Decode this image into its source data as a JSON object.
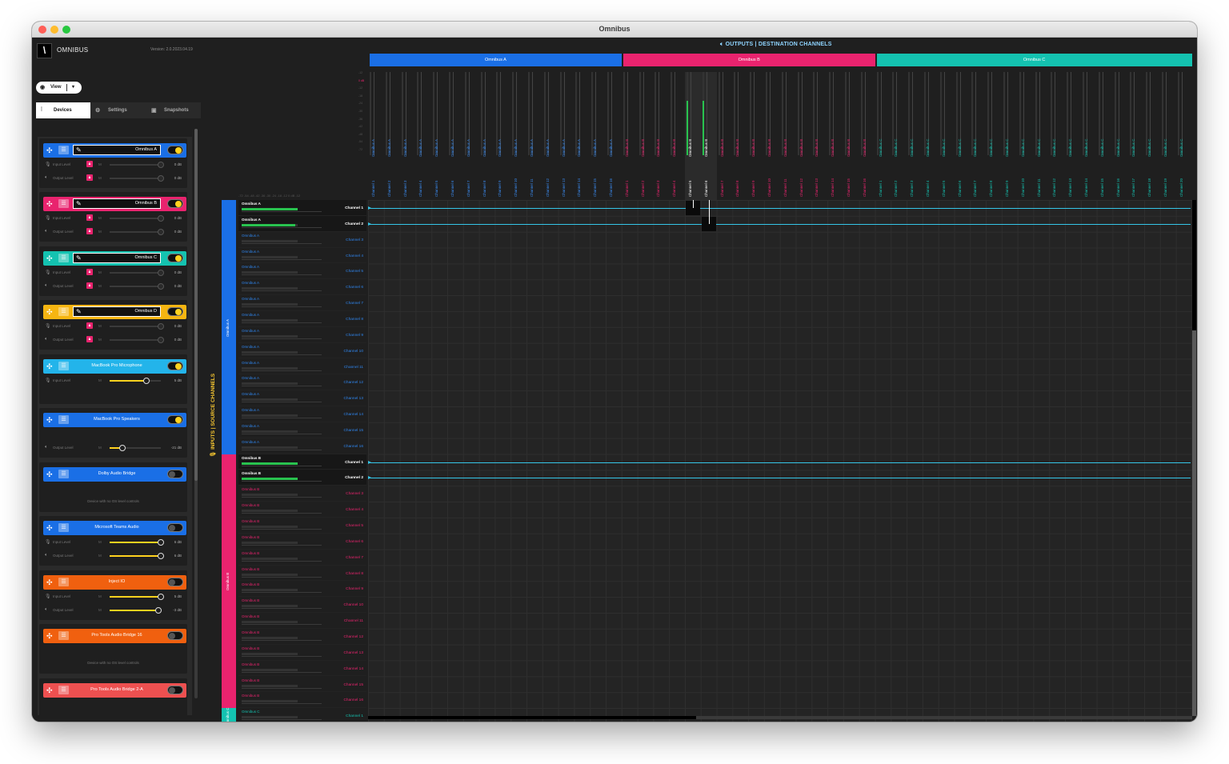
{
  "window": {
    "title": "Omnibus"
  },
  "app": {
    "logo": "\\",
    "name": "OMNIBUS",
    "version": "Version: 2.0.2023.04.19"
  },
  "view_button": {
    "label": "View",
    "icon": "eye-icon",
    "dropdown": "▾"
  },
  "tabs": [
    {
      "label": "Devices",
      "icon": "devices-icon"
    },
    {
      "label": "Settings",
      "icon": "gear-icon"
    },
    {
      "label": "Snapshots",
      "icon": "snapshot-icon"
    }
  ],
  "device_labels": {
    "input_level": "Input Level",
    "output_level": "Output Level",
    "mute": "M",
    "no_os": "Device with no OS level controls"
  },
  "devices": [
    {
      "name": "Omnibus A",
      "color": "#1a6fe6",
      "enabled": true,
      "editable": true,
      "rows": [
        {
          "kind": "input",
          "db": "0 dB",
          "level": 0
        },
        {
          "kind": "output",
          "db": "0 dB",
          "level": 0
        }
      ]
    },
    {
      "name": "Omnibus B",
      "color": "#e9236e",
      "enabled": true,
      "editable": true,
      "rows": [
        {
          "kind": "input",
          "db": "0 dB",
          "level": 0
        },
        {
          "kind": "output",
          "db": "0 dB",
          "level": 0
        }
      ]
    },
    {
      "name": "Omnibus C",
      "color": "#14c2b0",
      "enabled": true,
      "editable": true,
      "rows": [
        {
          "kind": "input",
          "db": "0 dB",
          "level": 0
        },
        {
          "kind": "output",
          "db": "0 dB",
          "level": 0
        }
      ]
    },
    {
      "name": "Omnibus D",
      "color": "#f6b511",
      "enabled": true,
      "editable": true,
      "rows": [
        {
          "kind": "input",
          "db": "0 dB",
          "level": 0
        },
        {
          "kind": "output",
          "db": "0 dB",
          "level": 0
        }
      ]
    },
    {
      "name": "MacBook Pro Microphone",
      "color": "#23b4ea",
      "enabled": true,
      "editable": false,
      "rows": [
        {
          "kind": "input",
          "db": "5 dB",
          "level": 0.72
        }
      ]
    },
    {
      "name": "MacBook Pro Speakers",
      "color": "#1a6fe6",
      "enabled": true,
      "editable": false,
      "rows": [
        {
          "kind": "output",
          "db": "-21 dB",
          "level": 0.25
        }
      ]
    },
    {
      "name": "Dolby Audio Bridge",
      "color": "#1a6fe6",
      "enabled": false,
      "editable": false,
      "no_os": true,
      "rows": []
    },
    {
      "name": "Microsoft Teams Audio",
      "color": "#1a6fe6",
      "enabled": false,
      "editable": false,
      "rows": [
        {
          "kind": "input",
          "db": "6 dB",
          "level": 1.0
        },
        {
          "kind": "output",
          "db": "6 dB",
          "level": 1.0
        }
      ]
    },
    {
      "name": "Inject IO",
      "color": "#f0600f",
      "enabled": false,
      "editable": false,
      "rows": [
        {
          "kind": "input",
          "db": "5 dB",
          "level": 1.0
        },
        {
          "kind": "output",
          "db": "-3 dB",
          "level": 0.95
        }
      ]
    },
    {
      "name": "Pro Tools Audio Bridge 16",
      "color": "#f0600f",
      "enabled": false,
      "editable": false,
      "no_os": true,
      "rows": []
    },
    {
      "name": "Pro Tools Audio Bridge 2-A",
      "color": "#ee5050",
      "enabled": false,
      "editable": false,
      "rows": []
    }
  ],
  "outputs": {
    "title": "OUTPUTS | DESTINATION CHANNELS",
    "icon": "speaker-icon",
    "groups": [
      {
        "name": "Omnibus A",
        "color": "#1a6fe6",
        "text_color": "#3a8bf0",
        "channels": 16
      },
      {
        "name": "Omnibus B",
        "color": "#e9236e",
        "text_color": "#e9236e",
        "channels": 16
      },
      {
        "name": "Omnibus C",
        "color": "#14c2b0",
        "text_color": "#14c2b0",
        "channels": 20
      }
    ],
    "meter_scale": [
      "-12",
      "0 dB",
      "-12",
      "-18",
      "-24",
      "-30",
      "-36",
      "-42",
      "-48",
      "-54",
      "-72"
    ],
    "active_columns": [
      {
        "group": 1,
        "channel": 5,
        "level": 0.65
      },
      {
        "group": 1,
        "channel": 6,
        "level": 0.65
      }
    ]
  },
  "inputs": {
    "title": "INPUTS | SOURCE CHANNELS",
    "icon": "microphone-icon",
    "db_scale": "-72  -54  -48  -42  -36  -30  -24  -18  -12  0 dB  -12",
    "groups": [
      {
        "name": "Omnibus A",
        "color": "#1a6fe6",
        "text_color": "#2f86ef",
        "channels": 16,
        "active": [
          {
            "channel": 1,
            "level": 1.0
          },
          {
            "channel": 2,
            "level": 0.95
          }
        ]
      },
      {
        "name": "Omnibus B",
        "color": "#e9236e",
        "text_color": "#e9236e",
        "channels": 16,
        "active": [
          {
            "channel": 1,
            "level": 1.0
          },
          {
            "channel": 2,
            "level": 1.0
          }
        ]
      },
      {
        "name": "Omnibus C",
        "color": "#14c2b0",
        "text_color": "#14c2b0",
        "channels": 1,
        "active": []
      }
    ]
  },
  "channel_prefix": "Channel",
  "routes": [
    {
      "in_group": 0,
      "in_channel": 1,
      "out_group": 1,
      "out_channel": 5
    },
    {
      "in_group": 0,
      "in_channel": 2,
      "out_group": 1,
      "out_channel": 6
    }
  ]
}
